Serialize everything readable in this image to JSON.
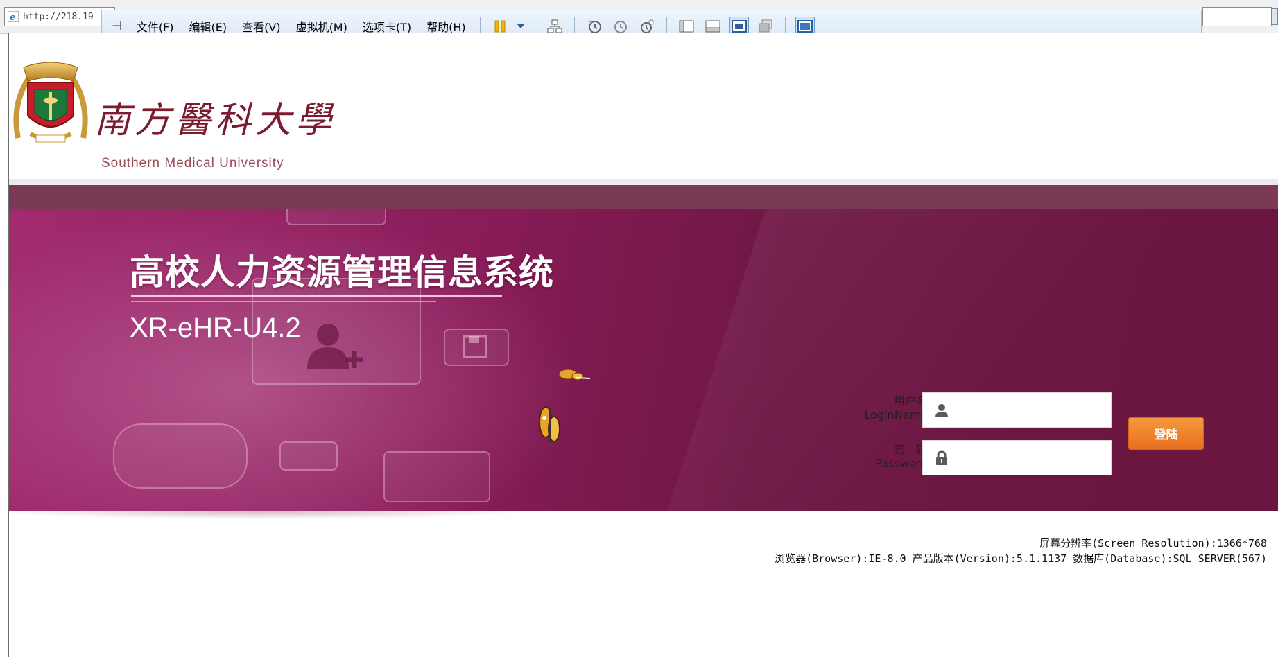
{
  "browser": {
    "url_fragment": "http://218.19",
    "favicon": "ie-icon"
  },
  "vm_toolbar": {
    "pin": "pin-icon",
    "menus": [
      {
        "label": "文件(F)",
        "name": "menu-file"
      },
      {
        "label": "编辑(E)",
        "name": "menu-edit"
      },
      {
        "label": "查看(V)",
        "name": "menu-view"
      },
      {
        "label": "虚拟机(M)",
        "name": "menu-vm"
      },
      {
        "label": "选项卡(T)",
        "name": "menu-tabs"
      },
      {
        "label": "帮助(H)",
        "name": "menu-help"
      }
    ],
    "buttons": [
      "pause-icon",
      "dropdown-icon",
      "network-icon",
      "snapshot-icon",
      "revert-snapshot-icon",
      "snapshot-manager-icon",
      "sidebar-icon",
      "console-view-icon",
      "fullscreen-icon",
      "unity-icon",
      "stretch-icon"
    ],
    "colors": {
      "pause": "#f1b400",
      "accent": "#3b78c4"
    }
  },
  "header": {
    "logo": "university-seal-icon",
    "name_cn": "南方醫科大學",
    "name_en": "Southern Medical University"
  },
  "banner": {
    "title": "高校人力资源管理信息系统",
    "version": "XR-eHR-U4.2",
    "colors": {
      "primary": "#8a1c5a",
      "dark": "#6a1640",
      "stripe": "#7a3a55"
    }
  },
  "login": {
    "username_label_cn": "用户名",
    "username_label_en": "LoginName",
    "password_label_cn": "密　码",
    "password_label_en": "Password",
    "username_value": "",
    "password_value": "",
    "username_icon": "user-icon",
    "password_icon": "lock-icon",
    "submit_label": "登陆",
    "colors": {
      "button": "#ee7d26"
    }
  },
  "footer": {
    "resolution": "屏幕分辨率(Screen Resolution):1366*768",
    "environment": "浏览器(Browser):IE-8.0 产品版本(Version):5.1.1137 数据库(Database):SQL SERVER(567)"
  }
}
